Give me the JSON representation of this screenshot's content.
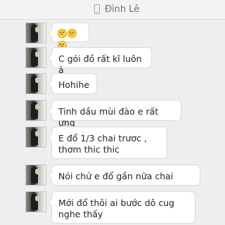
{
  "header": {
    "contact_name": "Đình Lê",
    "icon": "phone-icon"
  },
  "messages": [
    {
      "type": "emoji",
      "emoji": [
        "smiley",
        "smiley",
        "smiley"
      ]
    },
    {
      "text": "C gói đồ rất kĩ luôn á"
    },
    {
      "text": "Hohihe"
    },
    {
      "text": "Tinh dầu mùi đào e rất ưng"
    },
    {
      "text": "E đổ 1/3 chai trươc , thơm thic thic"
    },
    {
      "text": "Nói chứ e đổ gần nữa chai"
    },
    {
      "text": "Mới đổ thôi ai bước dô cug nghe thấy"
    }
  ]
}
